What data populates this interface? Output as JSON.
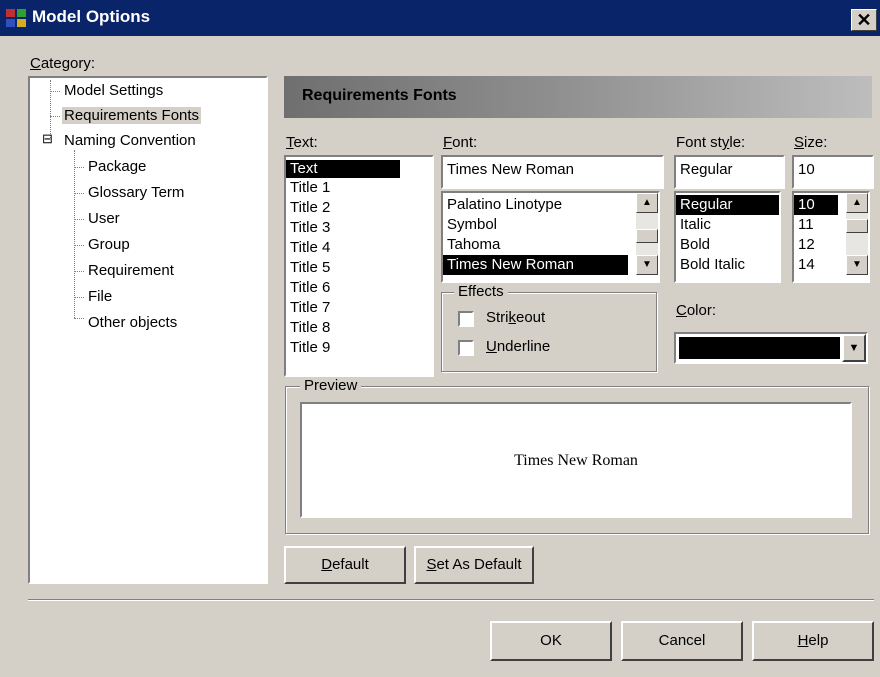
{
  "window": {
    "title": "Model Options",
    "close_glyph": "✕"
  },
  "category": {
    "label_accel": "C",
    "label_rest": "ategory:",
    "items": [
      "Model Settings",
      "Requirements Fonts",
      "Naming Convention",
      "Package",
      "Glossary Term",
      "User",
      "Group",
      "Requirement",
      "File",
      "Other objects"
    ],
    "selected": "Requirements Fonts",
    "expander": "⊟"
  },
  "panel": {
    "title": "Requirements Fonts"
  },
  "text_list": {
    "label_accel": "T",
    "label_rest": "ext:",
    "items": [
      "Text",
      "Title 1",
      "Title 2",
      "Title 3",
      "Title 4",
      "Title 5",
      "Title 6",
      "Title 7",
      "Title 8",
      "Title 9"
    ],
    "selected": "Text"
  },
  "font": {
    "label_accel": "F",
    "label_rest": "ont:",
    "value": "Times New Roman",
    "items": [
      "Palatino Linotype",
      "Symbol",
      "Tahoma",
      "Times New Roman"
    ],
    "selected": "Times New Roman"
  },
  "font_style": {
    "label_pre": "Font st",
    "label_accel": "y",
    "label_rest": "le:",
    "value": "Regular",
    "items": [
      "Regular",
      "Italic",
      "Bold",
      "Bold Italic"
    ],
    "selected": "Regular"
  },
  "size": {
    "label_accel": "S",
    "label_rest": "ize:",
    "value": "10",
    "items": [
      "10",
      "11",
      "12",
      "14"
    ],
    "selected": "10"
  },
  "effects": {
    "title": "Effects",
    "strikeout_pre": "Stri",
    "strikeout_accel": "k",
    "strikeout_rest": "eout",
    "underline_accel": "U",
    "underline_rest": "nderline",
    "strikeout_checked": false,
    "underline_checked": false
  },
  "color": {
    "label_accel": "C",
    "label_rest": "olor:",
    "value": "#000000"
  },
  "preview": {
    "title": "Preview",
    "sample": "Times New Roman"
  },
  "buttons": {
    "default_accel": "D",
    "default_rest": "efault",
    "set_default_accel": "S",
    "set_default_rest": "et As Default",
    "ok": "OK",
    "cancel": "Cancel",
    "help_accel": "H",
    "help_rest": "elp"
  },
  "colors": {
    "titlebar": "#0a246a",
    "face": "#d4d0c8",
    "selection": "#000000"
  }
}
